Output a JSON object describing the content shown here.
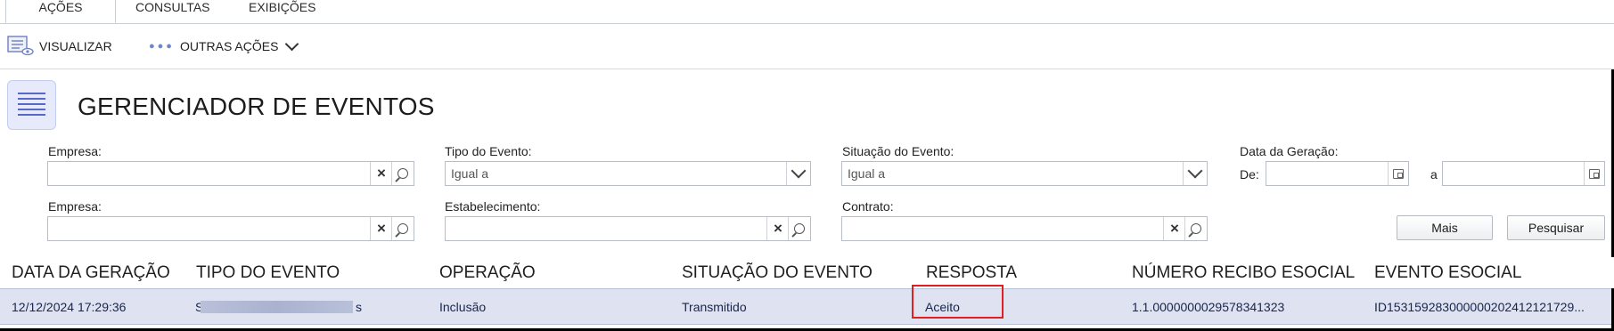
{
  "tabs": [
    {
      "label": "AÇÕES"
    },
    {
      "label": "CONSULTAS"
    },
    {
      "label": "EXIBIÇÕES"
    }
  ],
  "toolbar": {
    "visualizar": "VISUALIZAR",
    "outras_acoes": "OUTRAS AÇÕES"
  },
  "page": {
    "title": "GERENCIADOR DE EVENTOS"
  },
  "filters": {
    "empresa1_label": "Empresa:",
    "empresa1_value": "",
    "tipo_evento_label": "Tipo do Evento:",
    "tipo_evento_value": "Igual a",
    "situacao_label": "Situação do Evento:",
    "situacao_value": "Igual a",
    "data_geracao_label": "Data da Geração:",
    "de_label": "De:",
    "a_label": "a",
    "de_value": "",
    "a_value": "",
    "empresa2_label": "Empresa:",
    "empresa2_value": "",
    "estabelecimento_label": "Estabelecimento:",
    "estabelecimento_value": "",
    "contrato_label": "Contrato:",
    "contrato_value": "",
    "mais_button": "Mais",
    "pesquisar_button": "Pesquisar"
  },
  "grid": {
    "columns": [
      "DATA DA GERAÇÃO",
      "TIPO DO EVENTO",
      "OPERAÇÃO",
      "SITUAÇÃO DO EVENTO",
      "RESPOSTA",
      "NÚMERO RECIBO ESOCIAL",
      "EVENTO ESOCIAL"
    ],
    "rows": [
      {
        "data_geracao": "12/12/2024 17:29:36",
        "tipo_evento_start": "S",
        "tipo_evento_end": "s",
        "operacao": "Inclusão",
        "situacao": "Transmitido",
        "resposta": "Aceito",
        "numero_recibo": "1.1.0000000029578341323",
        "evento_esocial": "ID153159283000000202412121729..."
      }
    ]
  },
  "colors": {
    "selected_row": "#dfe3f1",
    "highlight": "#e02020",
    "accent": "#5868c8"
  }
}
